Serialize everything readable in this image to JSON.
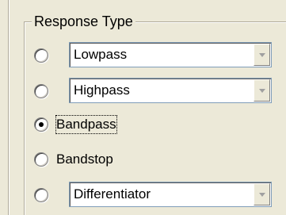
{
  "group": {
    "title": "Response Type"
  },
  "options": [
    {
      "label": "Lowpass",
      "selected": false,
      "control": "dropdown"
    },
    {
      "label": "Highpass",
      "selected": false,
      "control": "dropdown"
    },
    {
      "label": "Bandpass",
      "selected": true,
      "control": "label"
    },
    {
      "label": "Bandstop",
      "selected": false,
      "control": "label"
    },
    {
      "label": "Differentiator",
      "selected": false,
      "control": "dropdown"
    }
  ],
  "icons": {
    "radio": "radio-button-icon",
    "dropdown": "chevron-down-icon"
  },
  "colors": {
    "background": "#ece9d8",
    "field": "#ffffff",
    "border": "#7f9db9",
    "disabled_arrow": "#a0a0a0"
  }
}
